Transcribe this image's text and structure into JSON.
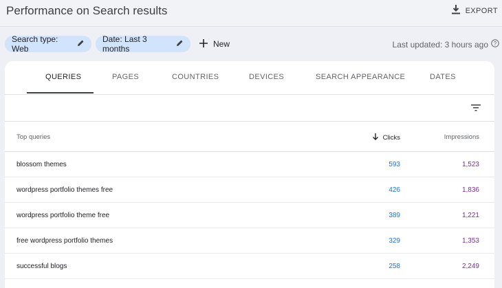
{
  "header": {
    "title": "Performance on Search results",
    "export_label": "EXPORT"
  },
  "filters": {
    "chips": [
      {
        "label": "Search type: Web"
      },
      {
        "label": "Date: Last 3 months"
      }
    ],
    "new_label": "New",
    "last_updated": "Last updated: 3 hours ago"
  },
  "tabs": [
    {
      "label": "QUERIES",
      "active": true
    },
    {
      "label": "PAGES",
      "active": false
    },
    {
      "label": "COUNTRIES",
      "active": false
    },
    {
      "label": "DEVICES",
      "active": false
    },
    {
      "label": "SEARCH APPEARANCE",
      "active": false
    },
    {
      "label": "DATES",
      "active": false
    }
  ],
  "table": {
    "columns": {
      "query": "Top queries",
      "clicks": "Clicks",
      "impressions": "Impressions"
    },
    "rows": [
      {
        "query": "blossom themes",
        "clicks": "593",
        "impressions": "1,523"
      },
      {
        "query": "wordpress portfolio themes free",
        "clicks": "426",
        "impressions": "1,836"
      },
      {
        "query": "wordpress portfolio theme free",
        "clicks": "389",
        "impressions": "1,221"
      },
      {
        "query": "free wordpress portfolio themes",
        "clicks": "329",
        "impressions": "1,353"
      },
      {
        "query": "successful blogs",
        "clicks": "258",
        "impressions": "2,249"
      }
    ]
  },
  "colors": {
    "clicks": "#1a73e8",
    "impressions": "#7b2c9a",
    "chip_bg": "#d2e3fc"
  }
}
